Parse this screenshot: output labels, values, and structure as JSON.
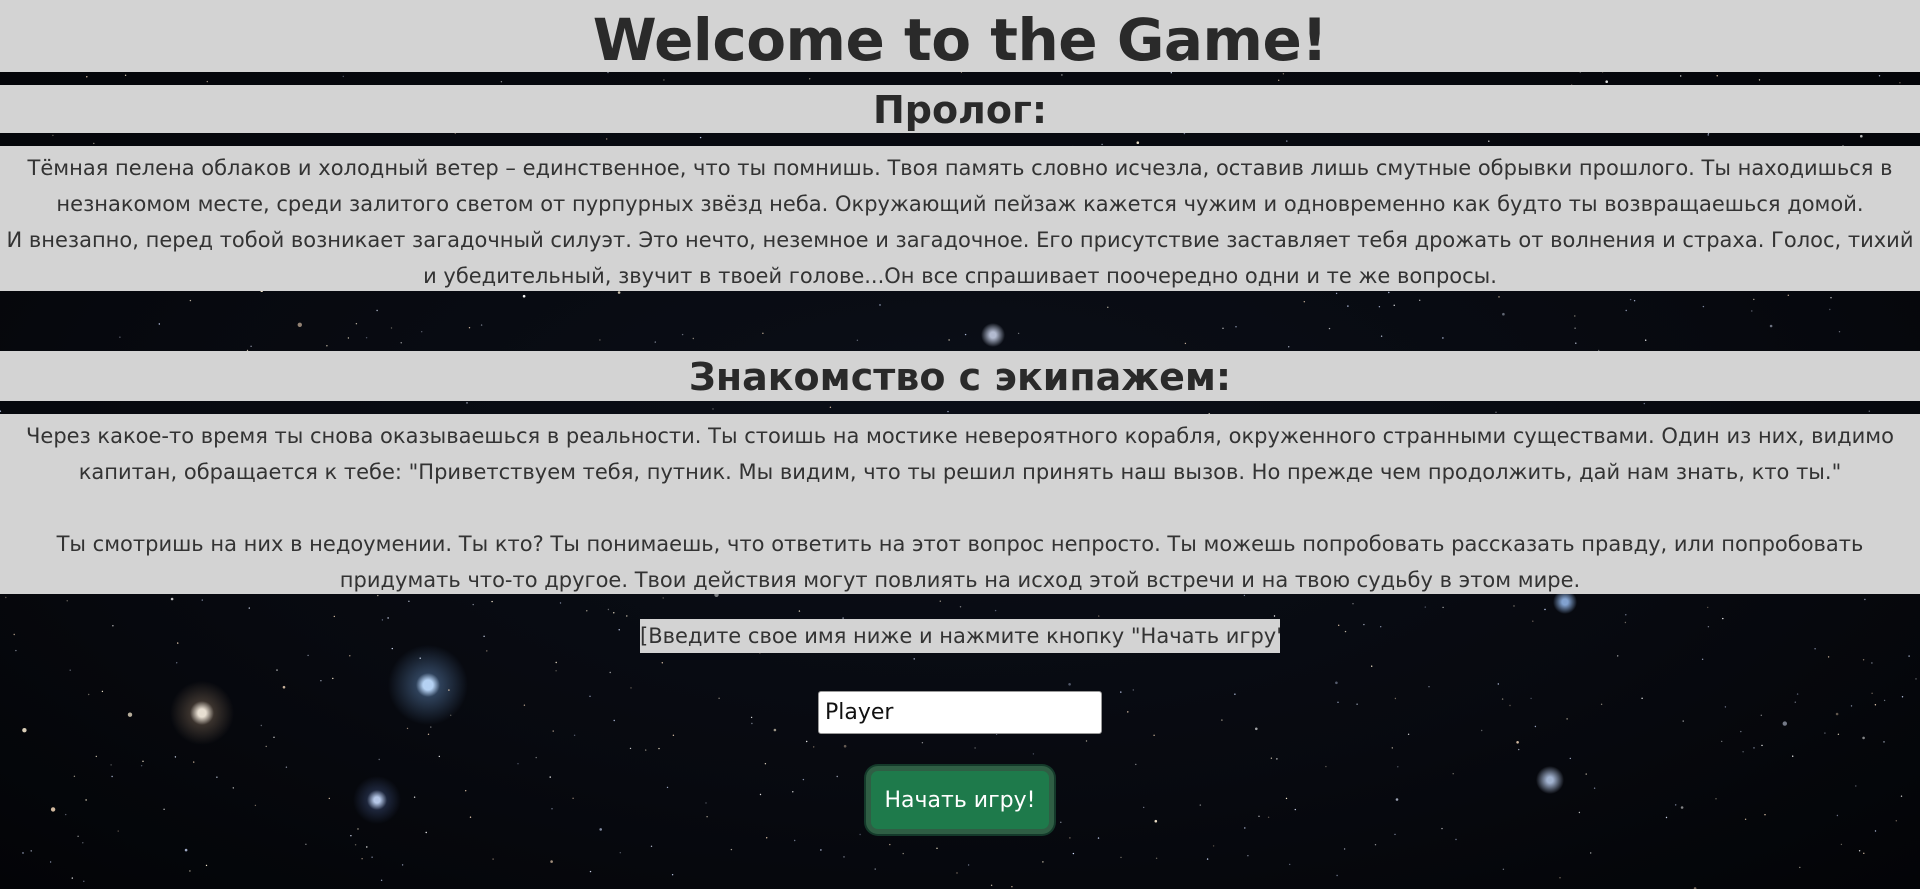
{
  "title": "Welcome to the Game!",
  "prolog": {
    "heading": "Пролог:",
    "paragraphs": [
      "Тёмная пелена облаков и холодный ветер – единственное, что ты помнишь. Твоя память словно исчезла, оставив лишь смутные обрывки прошлого. Ты находишься в незнакомом месте, среди залитого светом от пурпурных звёзд неба. Окружающий пейзаж кажется чужим и одновременно как будто ты возвращаешься домой.",
      "И внезапно, перед тобой возникает загадочный силуэт. Это нечто, неземное и загадочное. Его присутствие заставляет тебя дрожать от волнения и страха. Голос, тихий и убедительный, звучит в твоей голове...Он все спрашивает поочередно одни и те же вопросы."
    ]
  },
  "crew": {
    "heading": "Знакомство с экипажем:",
    "paragraphs": [
      "Через какое-то время ты снова оказываешься в реальности. Ты стоишь на мостике невероятного корабля, окруженного странными существами. Один из них, видимо капитан, обращается к тебе: \"Приветствуем тебя, путник. Мы видим, что ты решил принять наш вызов. Но прежде чем продолжить, дай нам знать, кто ты.\"",
      "Ты смотришь на них в недоумении. Ты кто? Ты понимаешь, что ответить на этот вопрос непросто. Ты можешь попробовать рассказать правду, или попробовать придумать что-то другое. Твои действия могут повлиять на исход этой встречи и на твою судьбу в этом мире."
    ]
  },
  "form": {
    "instruction": "[Введите свое имя ниже и нажмите кнопку \"Начать игру\"]",
    "name_value": "Player",
    "start_label": "Начать игру!"
  },
  "colors": {
    "band": "#d3d3d3",
    "button": "#1e7a4b",
    "background": "#07090f"
  },
  "icons": {
    "background": "starfield-background"
  }
}
